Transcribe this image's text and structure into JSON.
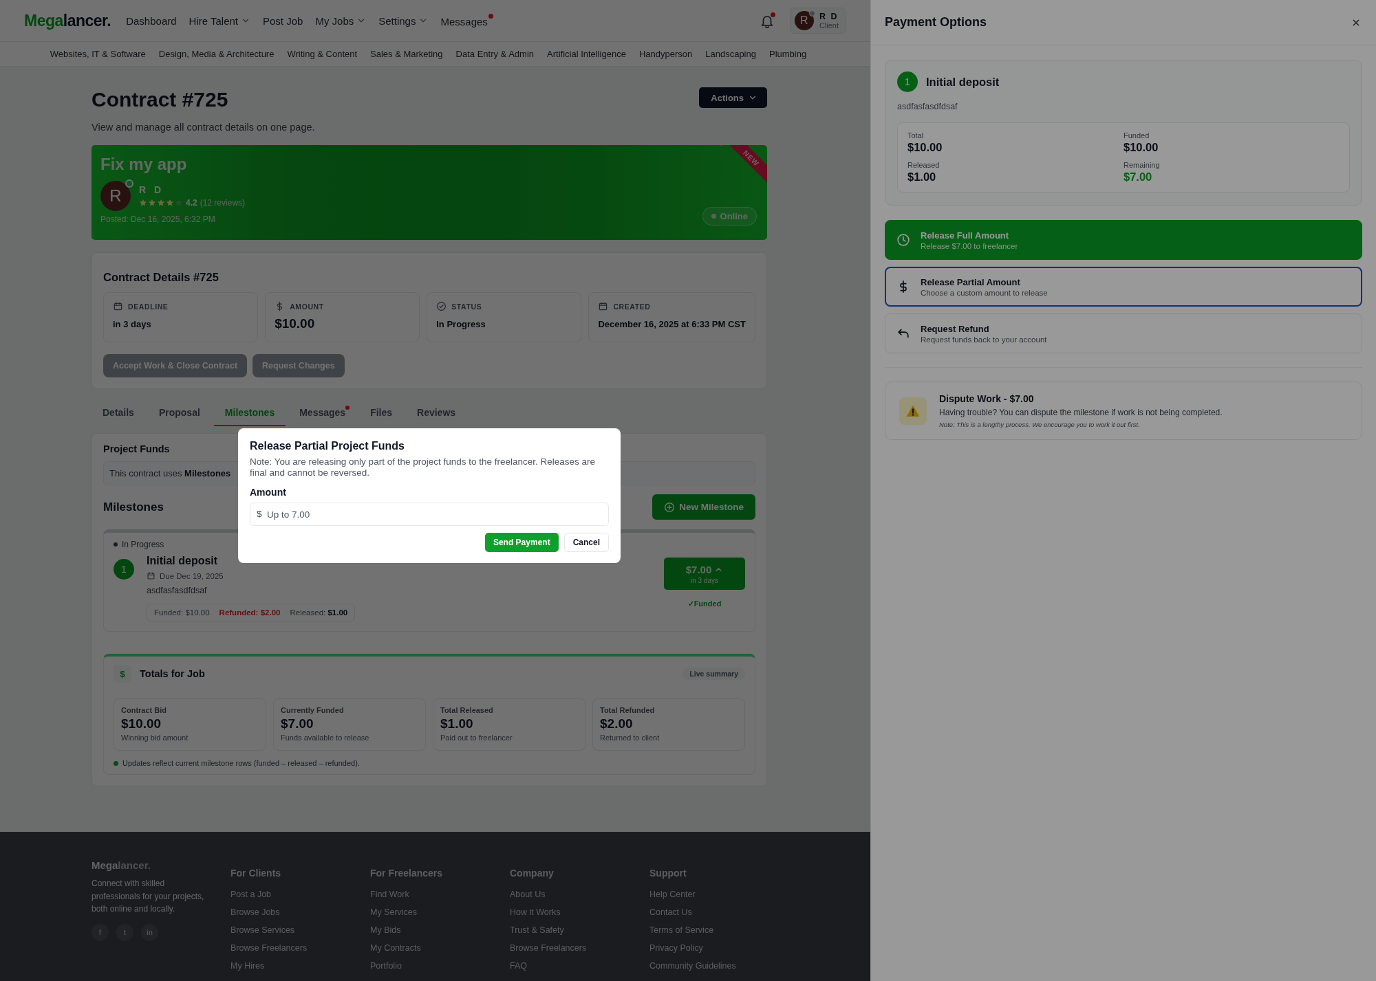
{
  "nav": {
    "logo": {
      "accent": "Mega",
      "rest": "lancer."
    },
    "items": [
      {
        "label": "Dashboard",
        "dropdown": false,
        "notification": false
      },
      {
        "label": "Hire Talent",
        "dropdown": true,
        "notification": false
      },
      {
        "label": "Post Job",
        "dropdown": false,
        "notification": false
      },
      {
        "label": "My Jobs",
        "dropdown": true,
        "notification": false
      },
      {
        "label": "Settings",
        "dropdown": true,
        "notification": false
      },
      {
        "label": "Messages",
        "dropdown": false,
        "notification": true
      }
    ],
    "notifications": true,
    "user": {
      "initial": "R",
      "name": "R D",
      "role": "Client",
      "online": false
    }
  },
  "categories": [
    "Websites, IT & Software",
    "Design, Media & Architecture",
    "Writing & Content",
    "Sales & Marketing",
    "Data Entry & Admin",
    "Artificial Intelligence",
    "Handyperson",
    "Landscaping",
    "Plumbing"
  ],
  "contract": {
    "title": "Contract #725",
    "subtitle": "View and manage all contract details on one page.",
    "actions": "Actions"
  },
  "banner": {
    "title": "Fix my app",
    "ribbon": "NEW",
    "freelancer": {
      "initial": "R",
      "name": "R D",
      "online": true,
      "stars": 4,
      "rating": "4.2",
      "reviews": "(12 reviews)"
    },
    "posted": "Posted: Dec 16, 2025, 6:32 PM",
    "presence": "Online"
  },
  "details": {
    "title": "Contract Details #725",
    "fields": [
      {
        "kind": "date",
        "label": "DEADLINE",
        "value": "in 3 days"
      },
      {
        "kind": "money",
        "label": "AMOUNT",
        "value": "$10.00"
      },
      {
        "kind": "status",
        "label": "STATUS",
        "value": "In Progress"
      },
      {
        "kind": "date",
        "label": "CREATED",
        "value": "December 16, 2025 at 6:33 PM CST"
      }
    ],
    "buttons": [
      {
        "label": "Accept Work & Close Contract",
        "disabled": true
      },
      {
        "label": "Request Changes",
        "disabled": true
      }
    ]
  },
  "tabs": [
    {
      "label": "Details",
      "selected": false,
      "notification": false
    },
    {
      "label": "Proposal",
      "selected": false,
      "notification": false
    },
    {
      "label": "Milestones",
      "selected": true,
      "notification": false
    },
    {
      "label": "Messages",
      "selected": false,
      "notification": true
    },
    {
      "label": "Files",
      "selected": false,
      "notification": false
    },
    {
      "label": "Reviews",
      "selected": false,
      "notification": false
    }
  ],
  "funds": {
    "title": "Project Funds",
    "info": "This contract uses **Milestones**"
  },
  "milestones": {
    "title": "Milestones",
    "new_button": "New Milestone",
    "items": [
      {
        "status": "In Progress",
        "number": "1",
        "title": "Initial deposit",
        "due": "Due Dec 19, 2025",
        "description": "asdfasfasdfdsaf",
        "amounts": [
          {
            "kind": "plain",
            "label": "Funded:",
            "value": "$10.00"
          },
          {
            "kind": "negative",
            "label": "Refunded:",
            "value": "$2.00"
          },
          {
            "kind": "strong",
            "label": "Released:",
            "value": "$1.00"
          }
        ],
        "amount": "$7.00",
        "expanded": true,
        "when": "in 3 days",
        "funded_label": "✓Funded"
      }
    ]
  },
  "totals": {
    "symbol": "$",
    "title": "Totals for Job",
    "badge": "Live summary",
    "stats": [
      {
        "label": "Contract Bid",
        "value": "$10.00",
        "note": "Winning bid amount"
      },
      {
        "label": "Currently Funded",
        "value": "$7.00",
        "note": "Funds available to release"
      },
      {
        "label": "Total Released",
        "value": "$1.00",
        "note": "Paid out to freelancer"
      },
      {
        "label": "Total Refunded",
        "value": "$2.00",
        "note": "Returned to client"
      }
    ],
    "footnote": "Updates reflect current milestone rows (funded – released – refunded)."
  },
  "footer": {
    "logo": {
      "accent": "Mega",
      "rest": "lancer."
    },
    "tagline": "Connect with skilled professionals for your projects, both online and locally.",
    "social": [
      "f",
      "t",
      "in"
    ],
    "columns": [
      {
        "title": "For Clients",
        "links": [
          "Post a Job",
          "Browse Jobs",
          "Browse Services",
          "Browse Freelancers",
          "My Hires"
        ]
      },
      {
        "title": "For Freelancers",
        "links": [
          "Find Work",
          "My Services",
          "My Bids",
          "My Contracts",
          "Portfolio"
        ]
      },
      {
        "title": "Company",
        "links": [
          "About Us",
          "How it Works",
          "Trust & Safety",
          "Browse Freelancers",
          "FAQ"
        ]
      },
      {
        "title": "Support",
        "links": [
          "Help Center",
          "Contact Us",
          "Terms of Service",
          "Privacy Policy",
          "Community Guidelines"
        ]
      }
    ]
  },
  "drawer": {
    "title": "Payment Options",
    "milestone": {
      "number": "1",
      "title": "Initial deposit",
      "description": "asdfasfasdfdsaf",
      "stats": [
        {
          "kind": "plain",
          "label": "Total",
          "value": "$10.00"
        },
        {
          "kind": "plain",
          "label": "Funded",
          "value": "$10.00"
        },
        {
          "kind": "plain",
          "label": "Released",
          "value": "$1.00"
        },
        {
          "kind": "positive",
          "label": "Remaining",
          "value": "$7.00"
        }
      ]
    },
    "options": [
      {
        "kind": "release_full",
        "title": "Release Full Amount",
        "subtitle": "Release $7.00 to freelancer",
        "selected": false
      },
      {
        "kind": "release_partial",
        "title": "Release Partial Amount",
        "subtitle": "Choose a custom amount to release",
        "selected": true
      },
      {
        "kind": "refund",
        "title": "Request Refund",
        "subtitle": "Request funds back to your account",
        "selected": false
      }
    ],
    "dispute": {
      "title": "Dispute Work - $7.00",
      "text": "Having trouble? You can dispute the milestone if work is not being completed.",
      "note": "Note: This is a lengthy process. We encourage you to work it out first."
    }
  },
  "dialog": {
    "title": "Release Partial Project Funds",
    "note": "Note: You are releasing only part of the project funds to the freelancer. Releases are final and cannot be reversed.",
    "label": "Amount",
    "prefix": "$",
    "placeholder": "Up to 7.00",
    "buttons": [
      {
        "kind": "primary",
        "label": "Send Payment"
      },
      {
        "kind": "secondary",
        "label": "Cancel"
      }
    ]
  }
}
